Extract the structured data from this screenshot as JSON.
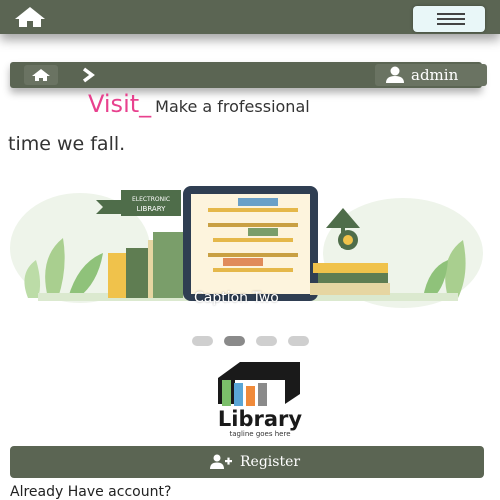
{
  "navbar": {
    "home_icon": "home-icon",
    "menu_icon": "hamburger-icon"
  },
  "breadcrumb": {
    "home_icon": "home-icon",
    "next_icon": "chevron-right-icon",
    "user_label": "admin",
    "user_icon": "user-icon"
  },
  "marquee": {
    "highlight": "Visit_",
    "text": "Make a frofessional",
    "line2": "time we fall."
  },
  "carousel": {
    "caption": "Caption Two",
    "active_slide": 2,
    "slide_count": 4,
    "illustration": {
      "banner_line1": "ELECTRONIC",
      "banner_line2": "LIBRARY"
    }
  },
  "logo": {
    "name": "Library",
    "tagline": "tagline goes here"
  },
  "register": {
    "label": "Register",
    "icon": "add-user-icon"
  },
  "already_text": "Already Have account?",
  "colors": {
    "bar": "#5b6553",
    "accent": "#e8418e",
    "menu_bg": "#e9f7f8"
  }
}
